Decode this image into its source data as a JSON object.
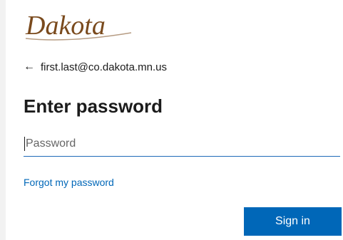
{
  "brand": {
    "logo_text": "Dakota",
    "logo_color": "#7a4a1d"
  },
  "identity": {
    "back_icon": "left-arrow-icon",
    "back_glyph": "←",
    "email": "first.last@co.dakota.mn.us"
  },
  "form": {
    "title": "Enter password",
    "password_placeholder": "Password",
    "password_value": "",
    "forgot_link": "Forgot my password",
    "signin_label": "Sign in"
  },
  "colors": {
    "accent": "#0067b8",
    "input_underline": "#1e6ab8",
    "text": "#1b1b1b"
  }
}
